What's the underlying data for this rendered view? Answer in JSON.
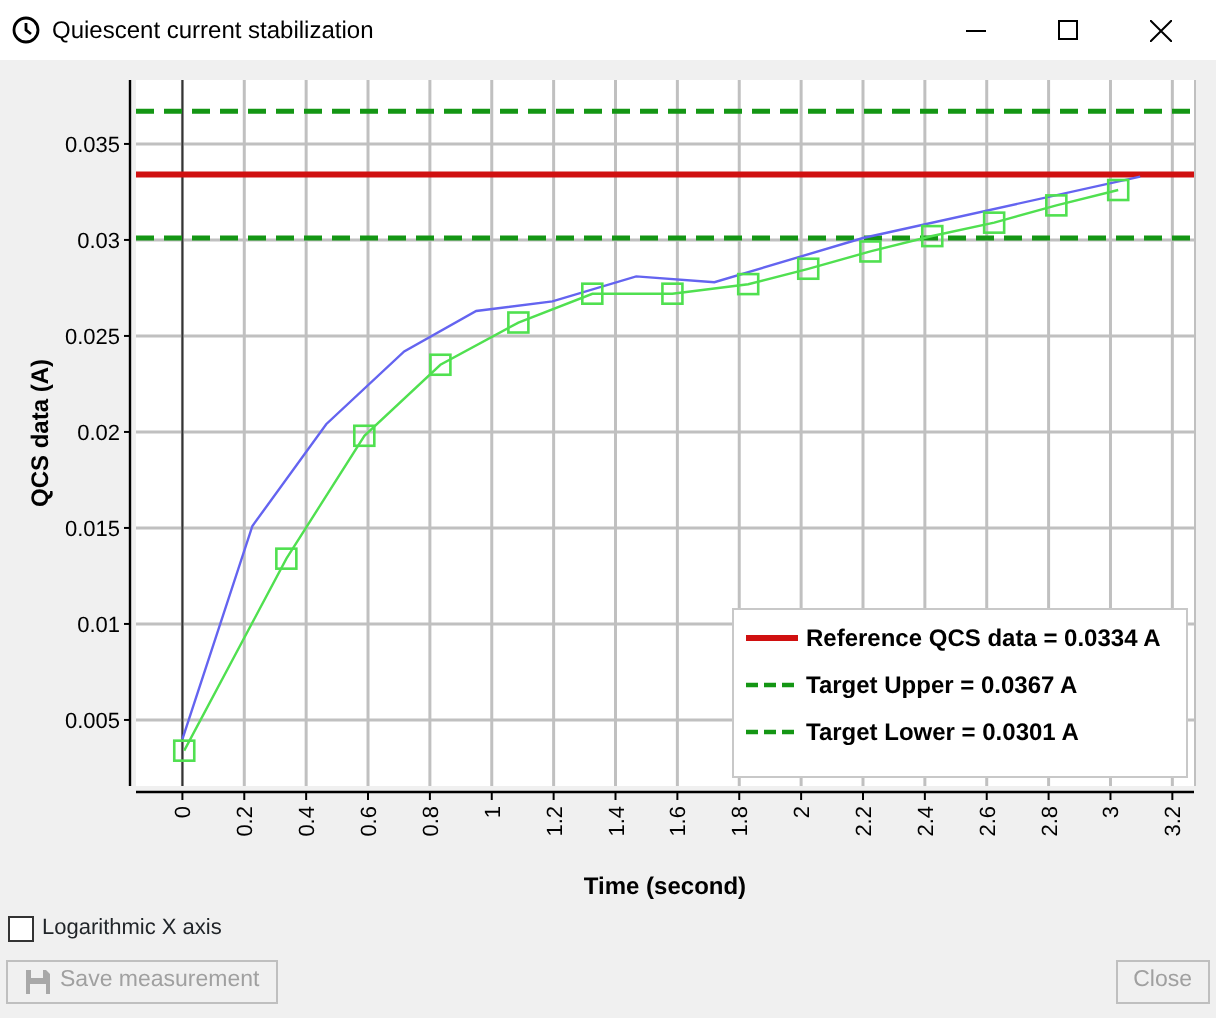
{
  "window": {
    "title": "Quiescent current stabilization"
  },
  "chart": {
    "chart_data": {
      "type": "line",
      "xlabel": "Time (second)",
      "ylabel": "QCS data (A)",
      "xlim": [
        -0.15,
        3.27
      ],
      "ylim": [
        0.00156,
        0.03833
      ],
      "xticks": [
        0,
        0.2,
        0.4,
        0.6,
        0.8,
        1,
        1.2,
        1.4,
        1.6,
        1.8,
        2,
        2.2,
        2.4,
        2.6,
        2.8,
        3,
        3.2
      ],
      "yticks": [
        0.005,
        0.01,
        0.015,
        0.02,
        0.025,
        0.03,
        0.035
      ],
      "series": [
        {
          "name": "Reference QCS data = 0.0334 A",
          "color": "#d01010",
          "line_style": "solid",
          "marker": "none",
          "x": [
            -0.15,
            3.27
          ],
          "values": [
            0.0334,
            0.0334
          ]
        },
        {
          "name": "Target Upper = 0.0367 A",
          "color": "#149614",
          "line_style": "dashed",
          "marker": "none",
          "x": [
            -0.15,
            3.27
          ],
          "values": [
            0.0367,
            0.0367
          ]
        },
        {
          "name": "Target Lower = 0.0301 A",
          "color": "#149614",
          "line_style": "dashed",
          "marker": "none",
          "x": [
            -0.15,
            3.27
          ],
          "values": [
            0.0301,
            0.0301
          ]
        },
        {
          "color": "#6464f0",
          "marker": "none",
          "x": [
            0,
            0.226,
            0.465,
            0.717,
            0.95,
            1.196,
            1.467,
            1.72,
            2.2,
            3.096
          ],
          "values": [
            0.004,
            0.0151,
            0.0204,
            0.0242,
            0.0263,
            0.0268,
            0.0281,
            0.0278,
            0.0301,
            0.0333
          ]
        },
        {
          "color": "#50e050",
          "marker": "square",
          "x": [
            0.006,
            0.336,
            0.588,
            0.834,
            1.086,
            1.325,
            1.584,
            1.829,
            2.023,
            2.224,
            2.424,
            2.624,
            2.825,
            3.025
          ],
          "values": [
            0.0034,
            0.0134,
            0.0198,
            0.0235,
            0.0257,
            0.0272,
            0.0272,
            0.0277,
            0.0285,
            0.0294,
            0.0302,
            0.0309,
            0.0318,
            0.0326
          ]
        }
      ],
      "grid": true,
      "legend": "lower right"
    }
  },
  "options": [
    {
      "label": "Logarithmic X axis",
      "checked": false
    }
  ],
  "buttons": [
    {
      "kind": "save",
      "label": "Save measurement",
      "disabled": true
    },
    {
      "kind": "plain",
      "label": "Close",
      "disabled": true
    }
  ]
}
